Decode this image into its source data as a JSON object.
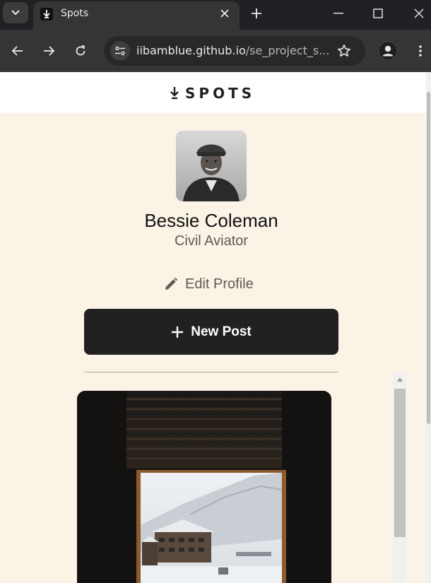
{
  "browser": {
    "tab_title": "Spots",
    "url_host": "iibamblue.github.io",
    "url_path": "/se_project_s..."
  },
  "header": {
    "logo_text": "SPOTS"
  },
  "profile": {
    "name": "Bessie Coleman",
    "job": "Civil Aviator",
    "edit_label": "Edit Profile",
    "new_post_label": "New Post"
  },
  "colors": {
    "page_bg": "#fbf3e5",
    "button_bg": "#212121",
    "chrome_bg": "#202124"
  }
}
